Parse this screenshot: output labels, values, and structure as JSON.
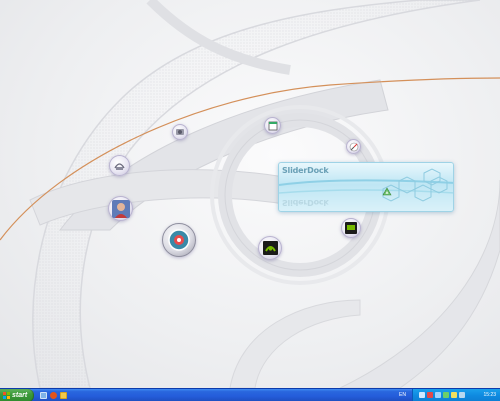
{
  "dock": {
    "title": "SliderDock",
    "reflection": "SliderDock"
  },
  "dock_icons": [
    {
      "name": "hardware-icon",
      "label": ""
    },
    {
      "name": "window-icon",
      "label": ""
    },
    {
      "name": "compass-icon",
      "label": ""
    },
    {
      "name": "network-icon",
      "label": ""
    },
    {
      "name": "user-avatar-icon",
      "label": ""
    },
    {
      "name": "slider-dock-icon",
      "label": ""
    },
    {
      "name": "nvidia-icon",
      "label": ""
    },
    {
      "name": "media-icon",
      "label": ""
    },
    {
      "name": "recycle-icon",
      "label": ""
    }
  ],
  "taskbar": {
    "start_label": "start",
    "language": "EN",
    "clock": "15:23"
  },
  "colors": {
    "taskbar_blue": "#245ddb",
    "start_green": "#3c9a3a",
    "tray_blue": "#0f8ae0",
    "dock_cyan": "#bfe6f4",
    "orb_lavender": "#c9c4dc",
    "wallpaper_arc_orange": "#d4905a"
  }
}
